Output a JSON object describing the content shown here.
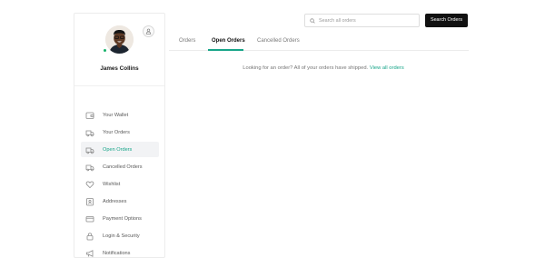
{
  "user": {
    "name": "James Collins",
    "status": "online"
  },
  "sidebar": {
    "items": [
      {
        "label": "Your Wallet",
        "icon": "wallet-icon",
        "active": false
      },
      {
        "label": "Your Orders",
        "icon": "truck-icon",
        "active": false
      },
      {
        "label": "Open Orders",
        "icon": "truck-icon",
        "active": true
      },
      {
        "label": "Cancelled Orders",
        "icon": "truck-icon",
        "active": false
      },
      {
        "label": "Wishlist",
        "icon": "heart-icon",
        "active": false
      },
      {
        "label": "Addresses",
        "icon": "address-book-icon",
        "active": false
      },
      {
        "label": "Payment Options",
        "icon": "credit-card-icon",
        "active": false
      },
      {
        "label": "Login & Security",
        "icon": "lock-icon",
        "active": false
      },
      {
        "label": "Notifications",
        "icon": "megaphone-icon",
        "active": false
      }
    ]
  },
  "search": {
    "placeholder": "Search all orders",
    "value": "",
    "button_label": "Search Orders"
  },
  "tabs": [
    {
      "label": "Orders",
      "active": false
    },
    {
      "label": "Open Orders",
      "active": true
    },
    {
      "label": "Cancelled Orders",
      "active": false
    }
  ],
  "message": {
    "text": "Looking for an order? All of your orders have shipped.",
    "link": "View all orders"
  },
  "colors": {
    "accent": "#17a589",
    "online": "#17b26a",
    "button_bg": "#111111"
  }
}
